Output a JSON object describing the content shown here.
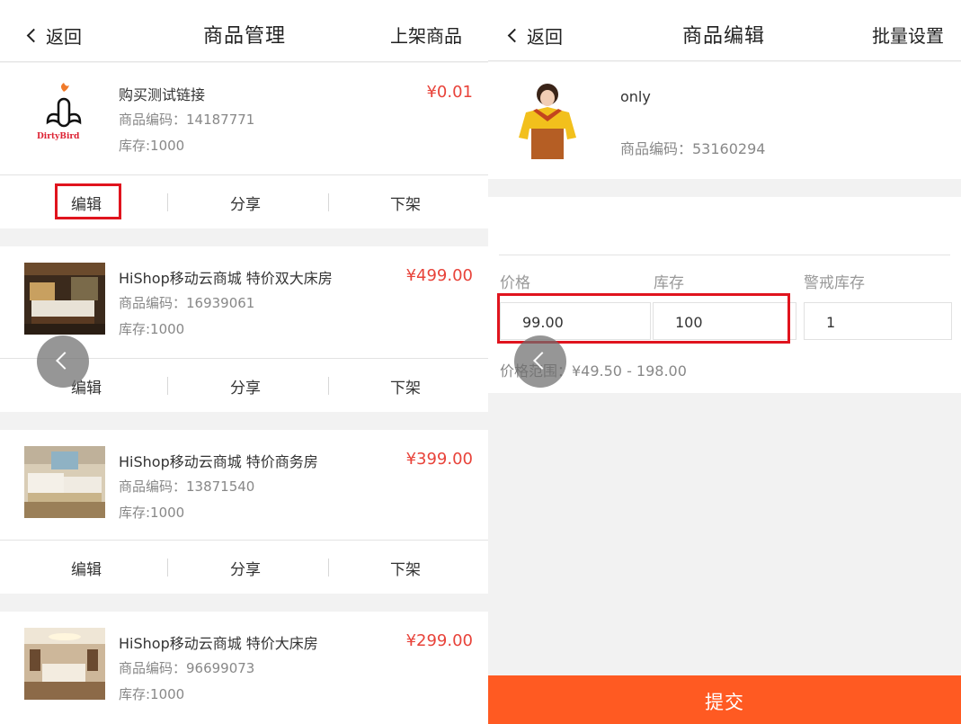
{
  "left": {
    "header": {
      "back_label": "返回",
      "title": "商品管理",
      "action_label": "上架商品"
    },
    "products": [
      {
        "name": "购买测试链接",
        "code": "商品编码：14187771",
        "stock": "库存:1000",
        "price": "¥0.01",
        "actions": [
          "编辑",
          "分享",
          "下架"
        ],
        "image_icon": "dirtybird-logo",
        "logo_text": "DirtyBird"
      },
      {
        "name": "HiShop移动云商城 特价双大床房",
        "code": "商品编码：16939061",
        "stock": "库存:1000",
        "price": "¥499.00",
        "actions": [
          "编辑",
          "分享",
          "下架"
        ],
        "image_icon": "hotel-room-photo"
      },
      {
        "name": "HiShop移动云商城 特价商务房",
        "code": "商品编码：13871540",
        "stock": "库存:1000",
        "price": "¥399.00",
        "actions": [
          "编辑",
          "分享",
          "下架"
        ],
        "image_icon": "hotel-room-photo"
      },
      {
        "name": "HiShop移动云商城 特价大床房",
        "code": "商品编码：96699073",
        "stock": "库存:1000",
        "price": "¥299.00",
        "image_icon": "hotel-room-photo"
      }
    ]
  },
  "right": {
    "header": {
      "back_label": "返回",
      "title": "商品编辑",
      "action_label": "批量设置"
    },
    "product": {
      "name": "only",
      "code": "商品编码：53160294",
      "image_icon": "sweater-model-photo"
    },
    "fields": {
      "price_label": "价格",
      "price_value": "99.00",
      "stock_label": "库存",
      "stock_value": "100",
      "alert_label": "警戒库存",
      "alert_value": "1"
    },
    "price_range": "价格范围：¥49.50 - 198.00",
    "submit_label": "提交"
  },
  "colors": {
    "price": "#e8433a",
    "submit": "#ff5a22",
    "highlight": "#e0141e",
    "background": "#f2f2f2"
  }
}
